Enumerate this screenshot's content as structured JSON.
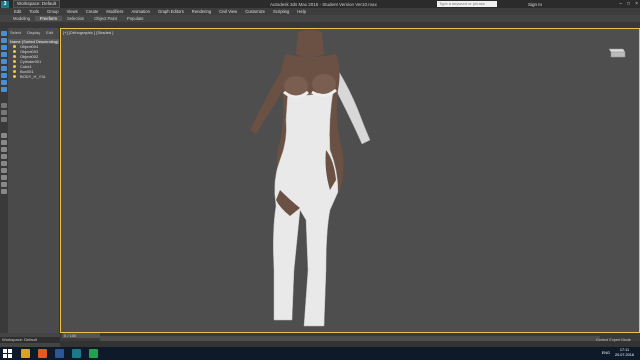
{
  "titlebar": {
    "workspace": "Workspace: Default",
    "title": "Autodesk 3ds Max 2016 - Student Version   Ver10.max",
    "search_placeholder": "Type a keyword or phrase",
    "signin": "Sign In"
  },
  "menu": [
    "Edit",
    "Tools",
    "Group",
    "Views",
    "Create",
    "Modifiers",
    "Animation",
    "Graph Editors",
    "Rendering",
    "Civil View",
    "Customize",
    "Scripting",
    "Help"
  ],
  "ribbon": {
    "tabs": [
      "Modeling",
      "Freeform",
      "Selection",
      "Object Paint",
      "Populate"
    ],
    "active_index": 1
  },
  "explorer": {
    "tabs": [
      "Select",
      "Display",
      "Edit"
    ],
    "header": "Name (Sorted Descending)",
    "items": [
      "Object004",
      "Object003",
      "Object002",
      "Cylinder001",
      "Cube1",
      "Box001",
      "BODY_H_Y3L"
    ]
  },
  "viewport": {
    "label": "[+] [Orthographic ] [Shaded ]"
  },
  "timeline": {
    "frame_counter": "0 / 100"
  },
  "status": {
    "workspace": "Workspace: Default",
    "mode": "Control Expert Mode"
  },
  "taskbar": {
    "lang": "ENG",
    "time": "17:11",
    "date": "20.07.2016"
  },
  "colors": {
    "selection_border": "#f0c040",
    "viewport_bg": "#4e4e4e",
    "suit_white": "#e9e9e9",
    "skin": "#6b5144"
  }
}
